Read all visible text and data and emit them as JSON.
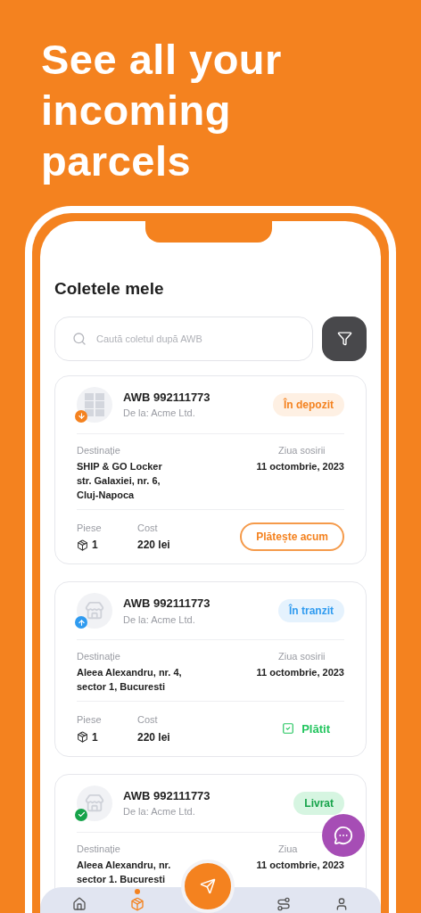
{
  "headline": [
    "See all your",
    "incoming",
    "parcels"
  ],
  "screen": {
    "title": "Coletele mele",
    "search": {
      "placeholder": "Caută coletul după AWB"
    },
    "parcels": [
      {
        "avatar": {
          "kind": "locker",
          "badge": {
            "kind": "in"
          }
        },
        "awb": "AWB 992111773",
        "sender": "De la: Acme Ltd.",
        "status": {
          "kind": "depot",
          "label": "În depozit"
        },
        "destination_label": "Destinație",
        "destination": [
          "SHIP & GO Locker",
          "str. Galaxiei, nr. 6,",
          "Cluj-Napoca"
        ],
        "arrival_label": "Ziua sosirii",
        "arrival": "11 octombrie, 2023",
        "pieces_label": "Piese",
        "pieces": "1",
        "cost_label": "Cost",
        "cost": "220 lei",
        "action": {
          "kind": "pay",
          "label": "Plătește acum"
        }
      },
      {
        "avatar": {
          "kind": "store",
          "badge": {
            "kind": "out"
          }
        },
        "awb": "AWB 992111773",
        "sender": "De la: Acme Ltd.",
        "status": {
          "kind": "transit",
          "label": "În tranzit"
        },
        "destination_label": "Destinație",
        "destination": [
          "Aleea Alexandru, nr. 4,",
          "sector 1, Bucuresti"
        ],
        "arrival_label": "Ziua sosirii",
        "arrival": "11 octombrie, 2023",
        "pieces_label": "Piese",
        "pieces": "1",
        "cost_label": "Cost",
        "cost": "220 lei",
        "action": {
          "kind": "paid",
          "label": "Plătit"
        }
      },
      {
        "avatar": {
          "kind": "store",
          "badge": {
            "kind": "done"
          }
        },
        "awb": "AWB 992111773",
        "sender": "De la: Acme Ltd.",
        "status": {
          "kind": "delivered",
          "label": "Livrat"
        },
        "destination_label": "Destinație",
        "destination": [
          "Aleea Alexandru, nr.",
          "sector 1. Bucuresti"
        ],
        "arrival_label": "Ziua",
        "arrival": "11 octombrie, 2023"
      }
    ],
    "nav": [
      {
        "kind": "home",
        "selected": false
      },
      {
        "kind": "parcels",
        "selected": true
      },
      {
        "kind": "send",
        "selected": false
      },
      {
        "kind": "routes",
        "selected": false
      },
      {
        "kind": "profile",
        "selected": false
      }
    ]
  }
}
